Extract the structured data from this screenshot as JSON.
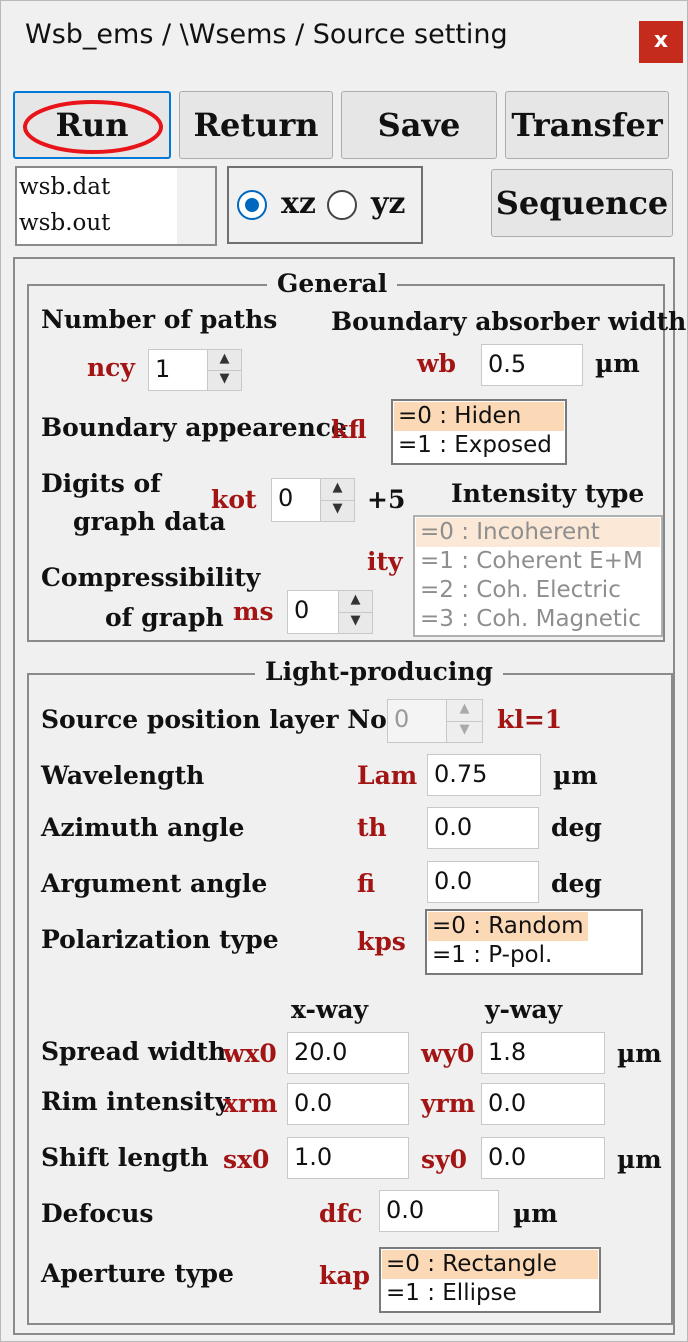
{
  "window": {
    "title": "Wsb_ems / \\Wsems / Source setting",
    "close_label": "x"
  },
  "toolbar": {
    "run": "Run",
    "return": "Return",
    "save": "Save",
    "transfer": "Transfer",
    "sequence": "Sequence"
  },
  "files": [
    "wsb.dat",
    "wsb.out"
  ],
  "plane": {
    "xz": "xz",
    "yz": "yz",
    "selected": "xz"
  },
  "general": {
    "legend": "General",
    "paths_label": "Number of paths",
    "paths_var": "ncy",
    "paths_value": "1",
    "absorber_label": "Boundary absorber width",
    "absorber_var": "wb",
    "absorber_value": "0.5",
    "absorber_unit": "µm",
    "appearance_label": "Boundary appearence",
    "appearance_var": "kfl",
    "appearance_options": [
      "=0 : Hiden",
      "=1 : Exposed"
    ],
    "digits_label_1": "Digits of",
    "digits_label_2": "graph data",
    "digits_var": "kot",
    "digits_value": "0",
    "digits_suffix": "+5",
    "intensity_label": "Intensity type",
    "intensity_var": "ity",
    "intensity_options": [
      "=0 : Incoherent",
      "=1 : Coherent E+M",
      "=2 : Coh. Electric",
      "=3 : Coh. Magnetic"
    ],
    "compress_label_1": "Compressibility",
    "compress_label_2": "of graph",
    "compress_var": "ms",
    "compress_value": "0"
  },
  "light": {
    "legend": "Light-producing",
    "layer_label": "Source position layer No.",
    "layer_value": "0",
    "layer_var": "kl=1",
    "wavelength_label": "Wavelength",
    "wavelength_var": "Lam",
    "wavelength_value": "0.75",
    "wavelength_unit": "µm",
    "azimuth_label": "Azimuth angle",
    "azimuth_var": "th",
    "azimuth_value": "0.0",
    "azimuth_unit": "deg",
    "argument_label": "Argument angle",
    "argument_var": "fi",
    "argument_value": "0.0",
    "argument_unit": "deg",
    "polarization_label": "Polarization type",
    "polarization_var": "kps",
    "polarization_options": [
      "=0 : Random",
      "=1 : P-pol."
    ],
    "xway": "x-way",
    "yway": "y-way",
    "spread_label": "Spread width",
    "spread_xvar": "wx0",
    "spread_x": "20.0",
    "spread_yvar": "wy0",
    "spread_y": "1.8",
    "spread_unit": "µm",
    "rim_label": "Rim intensity",
    "rim_xvar": "xrm",
    "rim_x": "0.0",
    "rim_yvar": "yrm",
    "rim_y": "0.0",
    "shift_label": "Shift length",
    "shift_xvar": "sx0",
    "shift_x": "1.0",
    "shift_yvar": "sy0",
    "shift_y": "0.0",
    "shift_unit": "µm",
    "defocus_label": "Defocus",
    "defocus_var": "dfc",
    "defocus_value": "0.0",
    "defocus_unit": "µm",
    "aperture_label": "Aperture type",
    "aperture_var": "kap",
    "aperture_options": [
      "=0 : Rectangle",
      "=1 : Ellipse"
    ]
  },
  "colors": {
    "variable": "#a31515",
    "selection": "#fbd8b6",
    "close": "#c42b1c",
    "accent": "#0067c0",
    "highlight_ring": "#e8141a"
  }
}
